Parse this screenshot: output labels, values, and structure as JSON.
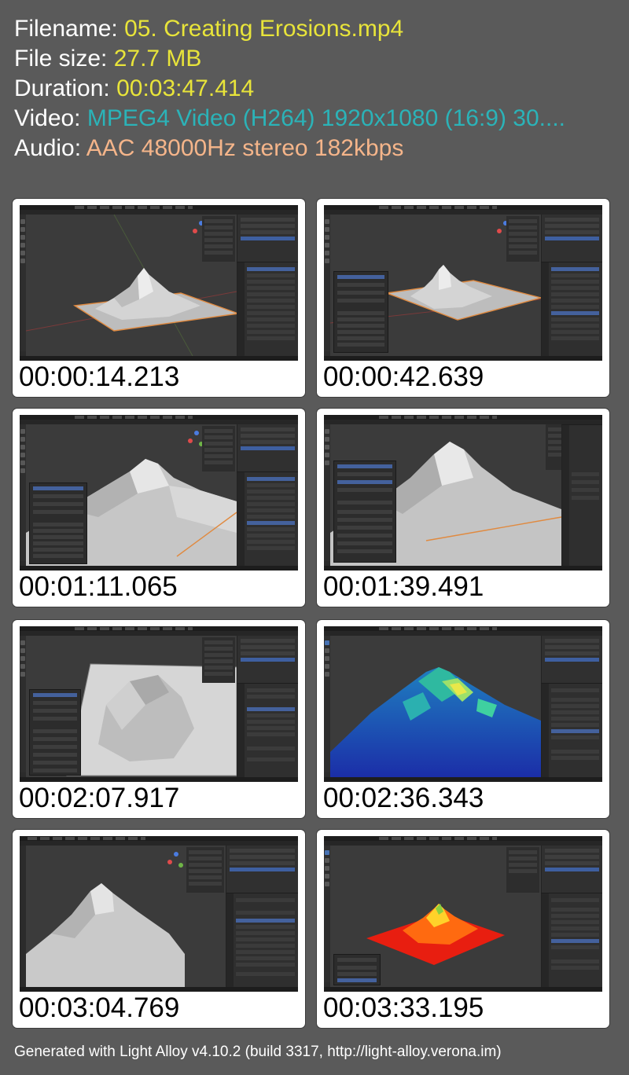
{
  "info": {
    "filename_label": "Filename: ",
    "filename_value": "05. Creating Erosions.mp4",
    "filesize_label": "File size: ",
    "filesize_value": "27.7 MB",
    "duration_label": "Duration: ",
    "duration_value": "00:03:47.414",
    "video_label": "Video: ",
    "video_value": "MPEG4 Video (H264) 1920x1080 (16:9) 30....",
    "audio_label": "Audio: ",
    "audio_value": "AAC 48000Hz stereo 182kbps"
  },
  "colors": {
    "filename": "#e8e43a",
    "video": "#2bb3b8",
    "audio": "#f5b58a",
    "background": "#5a5a5a"
  },
  "thumbnails": [
    {
      "timestamp": "00:00:14.213",
      "scene": "small-mountain-on-plane"
    },
    {
      "timestamp": "00:00:42.639",
      "scene": "mountain-with-operator-panel"
    },
    {
      "timestamp": "00:01:11.065",
      "scene": "closeup-mountain-with-panel"
    },
    {
      "timestamp": "00:01:39.491",
      "scene": "peak-closeup-with-panel"
    },
    {
      "timestamp": "00:02:07.917",
      "scene": "eroded-mountain-on-plane"
    },
    {
      "timestamp": "00:02:36.343",
      "scene": "blue-green-weight-map"
    },
    {
      "timestamp": "00:03:04.769",
      "scene": "mountain-side-view"
    },
    {
      "timestamp": "00:03:33.195",
      "scene": "red-yellow-weight-map"
    }
  ],
  "footer": "Generated with Light Alloy v4.10.2 (build 3317, http://light-alloy.verona.im)"
}
